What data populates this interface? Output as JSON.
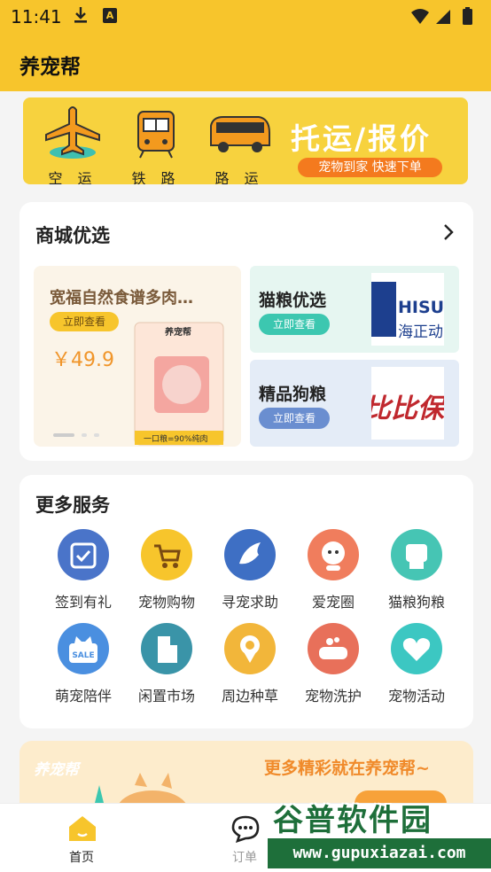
{
  "status_bar": {
    "time": "11:41",
    "icons": [
      "download-icon",
      "a-notification-icon",
      "wifi-icon",
      "signal-icon",
      "battery-icon"
    ]
  },
  "app": {
    "title": "养宠帮"
  },
  "banner": {
    "modes": [
      {
        "label": "空 运",
        "icon": "airplane-icon"
      },
      {
        "label": "铁 路",
        "icon": "train-icon"
      },
      {
        "label": "路 运",
        "icon": "bus-icon"
      }
    ],
    "slogan": "托运/报价",
    "pill": "宠物到家 快速下单"
  },
  "mall": {
    "title": "商城优选",
    "featured": {
      "name": "宽福自然食谱多肉…",
      "button": "立即查看",
      "price": "￥49.9",
      "bag_brand": "养宠帮",
      "bag_caption": "一口粮=90%纯肉"
    },
    "side": [
      {
        "name": "猫粮优选",
        "button": "立即查看",
        "logo_text": "HISU",
        "logo_sub": "海正动"
      },
      {
        "name": "精品狗粮",
        "button": "立即查看",
        "logo_text": "比比保"
      }
    ]
  },
  "services": {
    "title": "更多服务",
    "items": [
      {
        "label": "签到有礼",
        "icon": "calendar-check-icon",
        "color": "#4a74c9"
      },
      {
        "label": "宠物购物",
        "icon": "shopping-cart-icon",
        "color": "#f7c52c"
      },
      {
        "label": "寻宠求助",
        "icon": "bird-icon",
        "color": "#3e6fc4"
      },
      {
        "label": "爱宠圈",
        "icon": "pet-face-icon",
        "color": "#f07d5d"
      },
      {
        "label": "猫粮狗粮",
        "icon": "pet-food-icon",
        "color": "#46c5b4"
      },
      {
        "label": "萌宠陪伴",
        "icon": "sale-bag-icon",
        "color": "#4a8fe0"
      },
      {
        "label": "闲置市场",
        "icon": "building-icon",
        "color": "#3a94a8"
      },
      {
        "label": "周边种草",
        "icon": "location-icon",
        "color": "#f2b63a"
      },
      {
        "label": "宠物洗护",
        "icon": "bathtub-icon",
        "color": "#e8705a"
      },
      {
        "label": "宠物活动",
        "icon": "heart-icon",
        "color": "#3cc7c2"
      }
    ]
  },
  "promo": {
    "brand": "养宠帮",
    "text": "更多精彩就在养宠帮~"
  },
  "bottom_nav": [
    {
      "label": "首页",
      "icon": "home-icon",
      "active": true
    },
    {
      "label": "订单",
      "icon": "chat-bubble-icon",
      "active": false
    }
  ],
  "watermark": {
    "title": "谷普软件园",
    "url": "www.gupuxiazai.com"
  },
  "colors": {
    "brand_yellow": "#f7c52c",
    "accent_orange": "#f47a1e",
    "teal": "#3cc7b0",
    "blue": "#6a8ed0"
  }
}
